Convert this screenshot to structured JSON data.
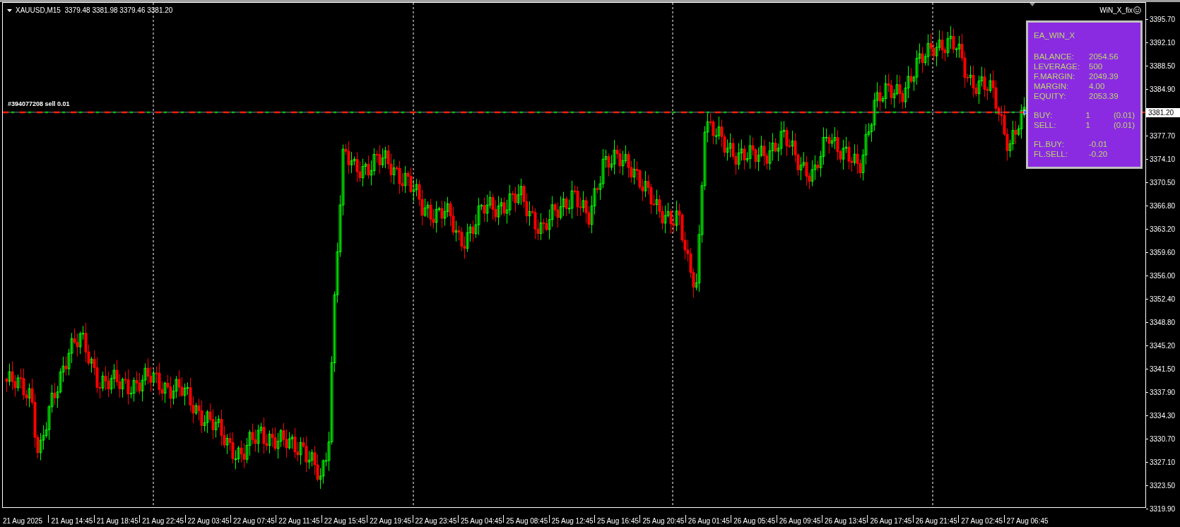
{
  "chart": {
    "header": "XAUUSD,M15  3379.48 3381.98 3379.46 3381.20",
    "expert_label": "WiN_X_fix",
    "order_label": "#394077208 sell 0.01",
    "price_axis": [
      {
        "text": "3395.70",
        "kind": "tick"
      },
      {
        "text": "3392.10",
        "kind": "tick"
      },
      {
        "text": "3388.50",
        "kind": "tick"
      },
      {
        "text": "3384.90",
        "kind": "tick"
      },
      {
        "text": "3381.20",
        "kind": "current"
      },
      {
        "text": "3377.70",
        "kind": "tick"
      },
      {
        "text": "3374.10",
        "kind": "tick"
      },
      {
        "text": "3370.50",
        "kind": "tick"
      },
      {
        "text": "3366.80",
        "kind": "tick"
      },
      {
        "text": "3363.20",
        "kind": "tick"
      },
      {
        "text": "3359.60",
        "kind": "tick"
      },
      {
        "text": "3356.00",
        "kind": "tick"
      },
      {
        "text": "3352.40",
        "kind": "tick"
      },
      {
        "text": "3348.80",
        "kind": "tick"
      },
      {
        "text": "3345.20",
        "kind": "tick"
      },
      {
        "text": "3341.50",
        "kind": "tick"
      },
      {
        "text": "3337.90",
        "kind": "tick"
      },
      {
        "text": "3334.30",
        "kind": "tick"
      },
      {
        "text": "3330.70",
        "kind": "tick"
      },
      {
        "text": "3327.10",
        "kind": "tick"
      },
      {
        "text": "3323.50",
        "kind": "tick"
      },
      {
        "text": "3319.90",
        "kind": "tick"
      }
    ],
    "time_axis": [
      "21 Aug 2025",
      "21 Aug 14:45",
      "21 Aug 18:45",
      "21 Aug 22:45",
      "22 Aug 03:45",
      "22 Aug 07:45",
      "22 Aug 11:45",
      "22 Aug 15:45",
      "22 Aug 19:45",
      "22 Aug 23:45",
      "25 Aug 04:45",
      "25 Aug 08:45",
      "25 Aug 12:45",
      "25 Aug 16:45",
      "25 Aug 20:45",
      "26 Aug 01:45",
      "26 Aug 05:45",
      "26 Aug 09:45",
      "26 Aug 13:45",
      "26 Aug 17:45",
      "26 Aug 21:45",
      "27 Aug 02:45",
      "27 Aug 06:45"
    ]
  },
  "panel": {
    "title": "EA_WIN_X",
    "groups": [
      [
        {
          "label": "BALANCE:",
          "value": "2054.56"
        },
        {
          "label": "LEVERAGE:",
          "value": "500"
        },
        {
          "label": "F.MARGIN:",
          "value": "2049.39"
        },
        {
          "label": "MARGIN:",
          "value": "4.00"
        },
        {
          "label": "EQUITY:",
          "value": "2053.39"
        }
      ],
      [
        {
          "label": "BUY:",
          "value": "1",
          "extra": "(0.01)"
        },
        {
          "label": "SELL:",
          "value": "1",
          "extra": "(0.01)"
        }
      ],
      [
        {
          "label": "FL.BUY:",
          "value": "-0.01"
        },
        {
          "label": "FL.SELL:",
          "value": "-0.20"
        }
      ]
    ]
  }
}
